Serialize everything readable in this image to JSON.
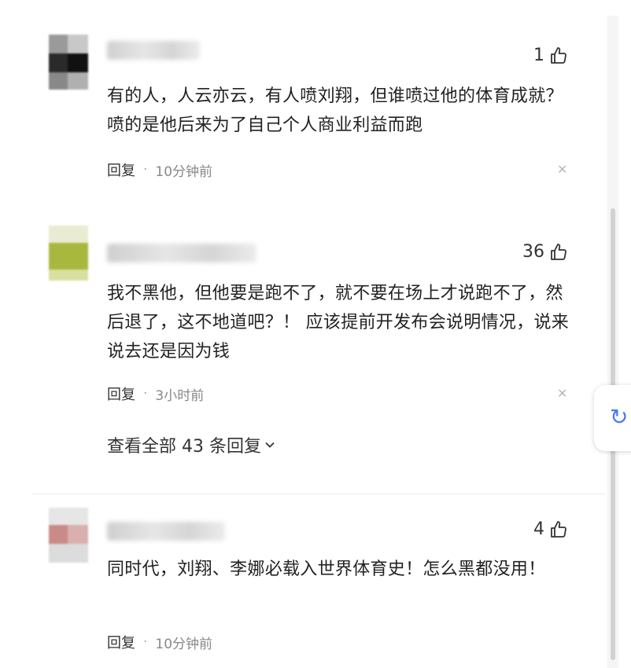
{
  "comments": [
    {
      "likes": "1",
      "text": "有的人，人云亦云，有人喷刘翔，但谁喷过他的体育成就？喷的是他后来为了自己个人商业利益而跑",
      "reply_label": "回复",
      "time": "10分钟前"
    },
    {
      "likes": "36",
      "text": "我不黑他，但他要是跑不了，就不要在场上才说跑不了，然后退了，这不地道吧？！ 应该提前开发布会说明情况，说来说去还是因为钱",
      "reply_label": "回复",
      "time": "3小时前"
    },
    {
      "likes": "4",
      "text": "同时代，刘翔、李娜必载入世界体育史！怎么黑都没用！",
      "reply_label": "回复",
      "time": "10分钟前"
    }
  ],
  "view_replies": {
    "label": "查看全部 43 条回复"
  },
  "icons": {
    "like": "thumbs-up-icon",
    "close": "close-icon",
    "expand": "chevron-down-icon",
    "float": "refresh-icon"
  },
  "colors": {
    "accent": "#4a7ce8",
    "meta": "#888888"
  }
}
